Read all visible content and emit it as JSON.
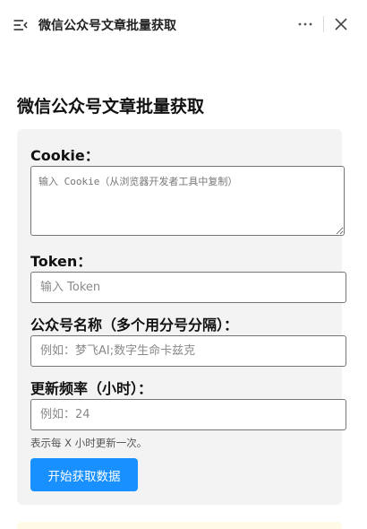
{
  "topbar": {
    "title": "微信公众号文章批量获取",
    "menu_icon": "menu-collapse-icon",
    "more_icon": "more-horizontal-icon",
    "close_icon": "close-icon"
  },
  "main": {
    "title": "微信公众号文章批量获取"
  },
  "form": {
    "cookie": {
      "label": "Cookie：",
      "placeholder": "输入 Cookie（从浏览器开发者工具中复制）",
      "value": ""
    },
    "token": {
      "label": "Token：",
      "placeholder": "输入 Token",
      "value": ""
    },
    "accounts": {
      "label": "公众号名称（多个用分号分隔）：",
      "placeholder": "例如：梦飞AI;数字生命卡兹克",
      "value": ""
    },
    "frequency": {
      "label": "更新频率（小时）：",
      "placeholder": "例如：24",
      "value": ""
    },
    "hint": "表示每 X 小时更新一次。",
    "submit_label": "开始获取数据"
  },
  "colors": {
    "primary": "#1890ff",
    "card_bg": "#f3f3f3",
    "notice_bg": "#fffbe6"
  }
}
